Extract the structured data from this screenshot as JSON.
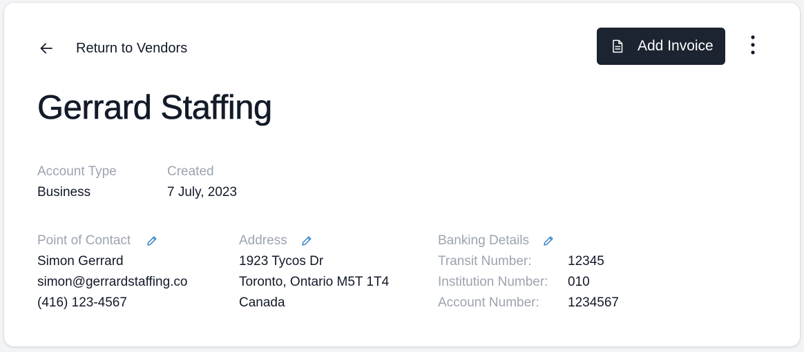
{
  "nav": {
    "back_label": "Return to Vendors",
    "back_icon": "arrow-left-icon"
  },
  "actions": {
    "add_invoice_label": "Add Invoice",
    "add_invoice_icon": "document-icon",
    "more_icon": "more-vertical-icon"
  },
  "vendor": {
    "name": "Gerrard Staffing",
    "account_type_label": "Account Type",
    "account_type_value": "Business",
    "created_label": "Created",
    "created_value": "7 July, 2023"
  },
  "contact": {
    "label": "Point of Contact",
    "name": "Simon Gerrard",
    "email": "simon@gerrardstaffing.co",
    "phone": "(416) 123-4567"
  },
  "address": {
    "label": "Address",
    "line1": "1923 Tycos Dr",
    "line2": "Toronto, Ontario M5T 1T4",
    "line3": "Canada"
  },
  "banking": {
    "label": "Banking Details",
    "transit_label": "Transit Number:",
    "transit_value": "12345",
    "institution_label": "Institution Number:",
    "institution_value": "010",
    "account_label": "Account Number:",
    "account_value": "1234567"
  },
  "colors": {
    "button_bg": "#1c2431",
    "label_gray": "#9ca3af",
    "edit_icon_blue": "#3b82c4"
  }
}
